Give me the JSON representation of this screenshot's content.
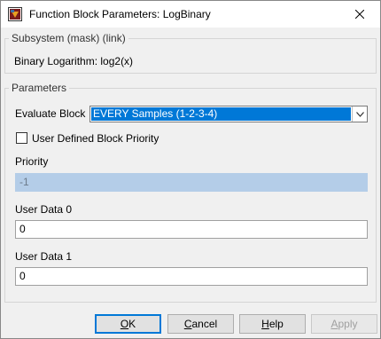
{
  "window": {
    "title": "Function Block Parameters: LogBinary"
  },
  "mask_group": {
    "legend": "Subsystem (mask) (link)",
    "description": "Binary Logarithm: log2(x)"
  },
  "params_group": {
    "legend": "Parameters",
    "evaluate_block_label": "Evaluate Block",
    "evaluate_block_value": "EVERY Samples (1-2-3-4)",
    "priority_checkbox_label": "User Defined Block Priority",
    "priority_checkbox_checked": false,
    "priority_label": "Priority",
    "priority_value": "-1",
    "user_data0_label": "User Data 0",
    "user_data0_value": "0",
    "user_data1_label": "User Data 1",
    "user_data1_value": "0"
  },
  "buttons": {
    "ok": {
      "pre": "",
      "mnemonic": "O",
      "post": "K"
    },
    "cancel": {
      "pre": "",
      "mnemonic": "C",
      "post": "ancel"
    },
    "help": {
      "pre": "",
      "mnemonic": "H",
      "post": "elp"
    },
    "apply": {
      "pre": "",
      "mnemonic": "A",
      "post": "pply"
    }
  },
  "icons": {
    "app": "simulink-block-icon",
    "close": "close-icon",
    "dropdown": "chevron-down-icon"
  },
  "colors": {
    "selection": "#0078d7",
    "disabled_field": "#b4cde8",
    "default_button_border": "#0078d7"
  }
}
